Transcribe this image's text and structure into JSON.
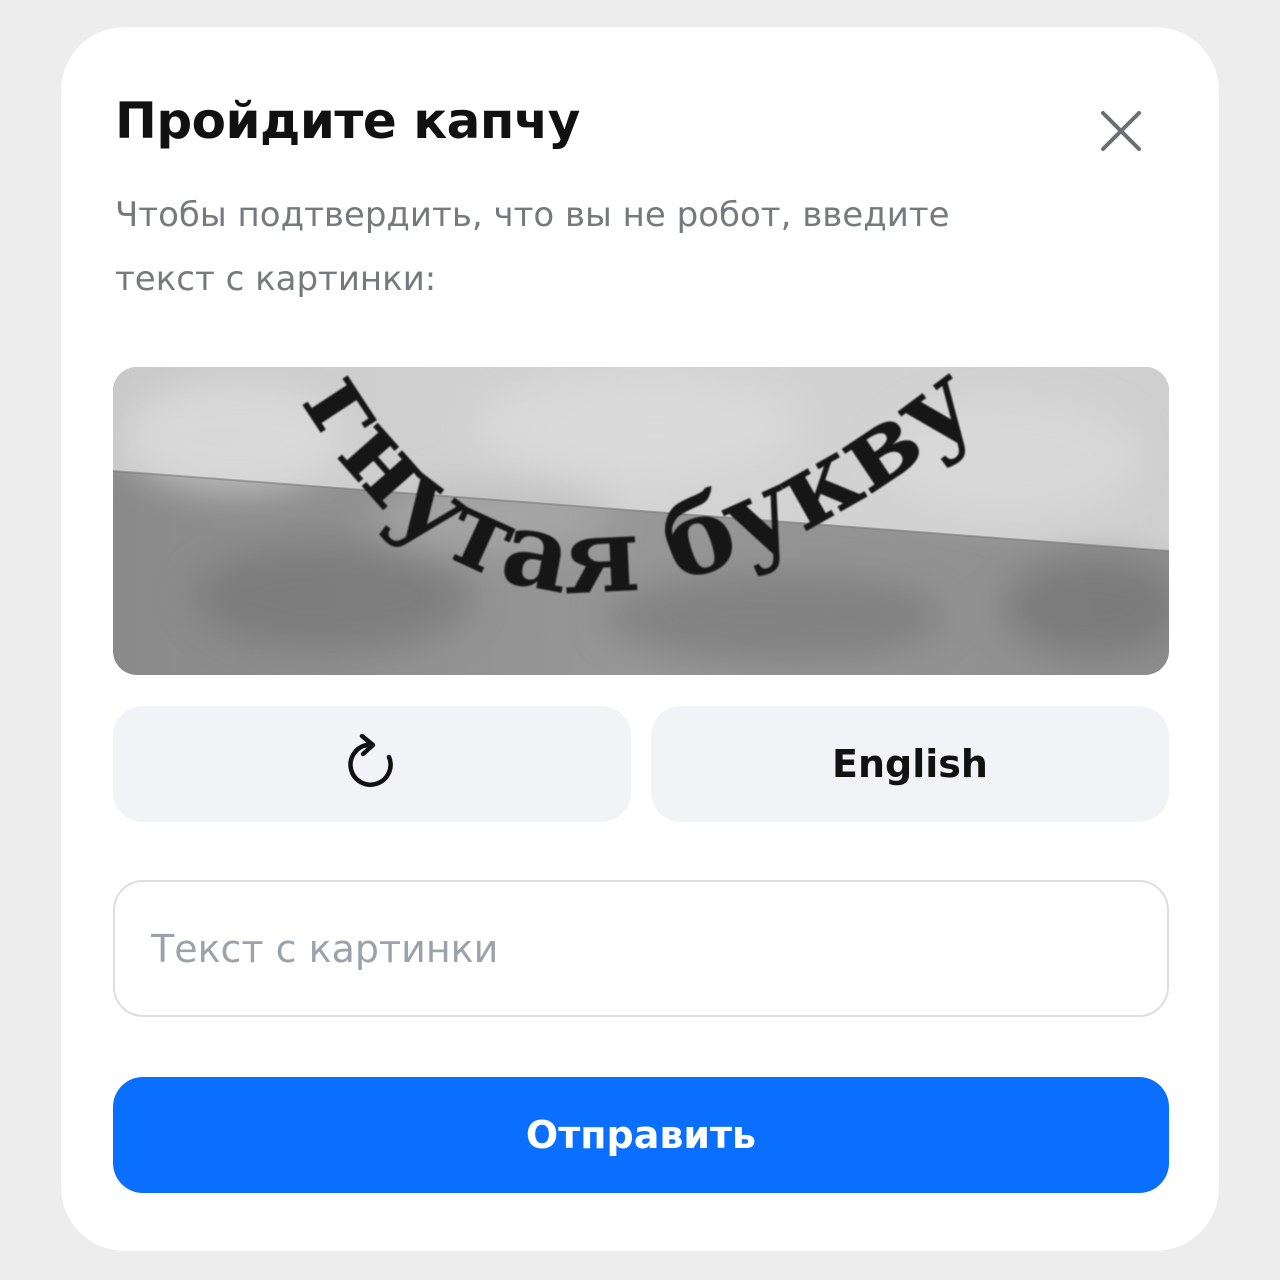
{
  "dialog": {
    "title": "Пройдите капчу",
    "subtitle": "Чтобы подтвердить, что вы не робот, введите текст с картинки:",
    "close_icon": "close-icon"
  },
  "captcha": {
    "text": "гнутая букву",
    "refresh_icon": "refresh-icon"
  },
  "buttons": {
    "language_label": "English",
    "submit_label": "Отправить"
  },
  "input": {
    "placeholder": "Текст с картинки",
    "value": ""
  },
  "colors": {
    "accent": "#0a6eff",
    "secondary_bg": "#f2f3f7",
    "title": "#111111",
    "subtitle": "#767a7f",
    "placeholder": "#9ba2ab",
    "backdrop": "#ededee"
  }
}
